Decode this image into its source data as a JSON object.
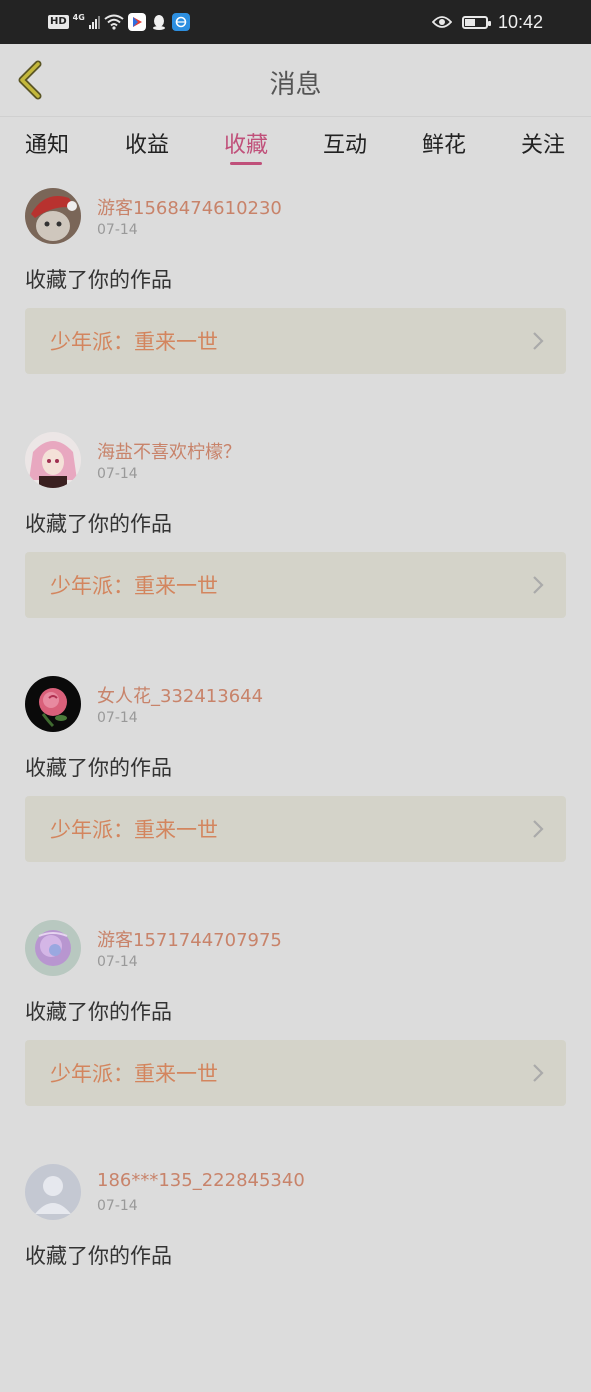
{
  "status": {
    "hd": "HD",
    "network": "4G",
    "time": "10:42",
    "battery_level": 0.5
  },
  "header": {
    "title": "消息"
  },
  "tabs": [
    {
      "label": "通知",
      "active": false
    },
    {
      "label": "收益",
      "active": false
    },
    {
      "label": "收藏",
      "active": true
    },
    {
      "label": "互动",
      "active": false
    },
    {
      "label": "鲜花",
      "active": false
    },
    {
      "label": "关注",
      "active": false
    }
  ],
  "items": [
    {
      "username": "游客1568474610230",
      "date": "07-14",
      "action": "收藏了你的作品",
      "work_title": "少年派：重来一世"
    },
    {
      "username": "海盐不喜欢柠檬？",
      "date": "07-14",
      "action": "收藏了你的作品",
      "work_title": "少年派：重来一世"
    },
    {
      "username": "女人花_332413644",
      "date": "07-14",
      "action": "收藏了你的作品",
      "work_title": "少年派：重来一世"
    },
    {
      "username": "游客1571744707975",
      "date": "07-14",
      "action": "收藏了你的作品",
      "work_title": "少年派：重来一世"
    },
    {
      "username": "186***135_222845340",
      "date": "07-14",
      "action": "收藏了你的作品",
      "work_title": ""
    }
  ],
  "colors": {
    "accent": "#c0507a",
    "username": "#c8836a",
    "work_title": "#d3855e",
    "background": "#dcdcdc"
  }
}
